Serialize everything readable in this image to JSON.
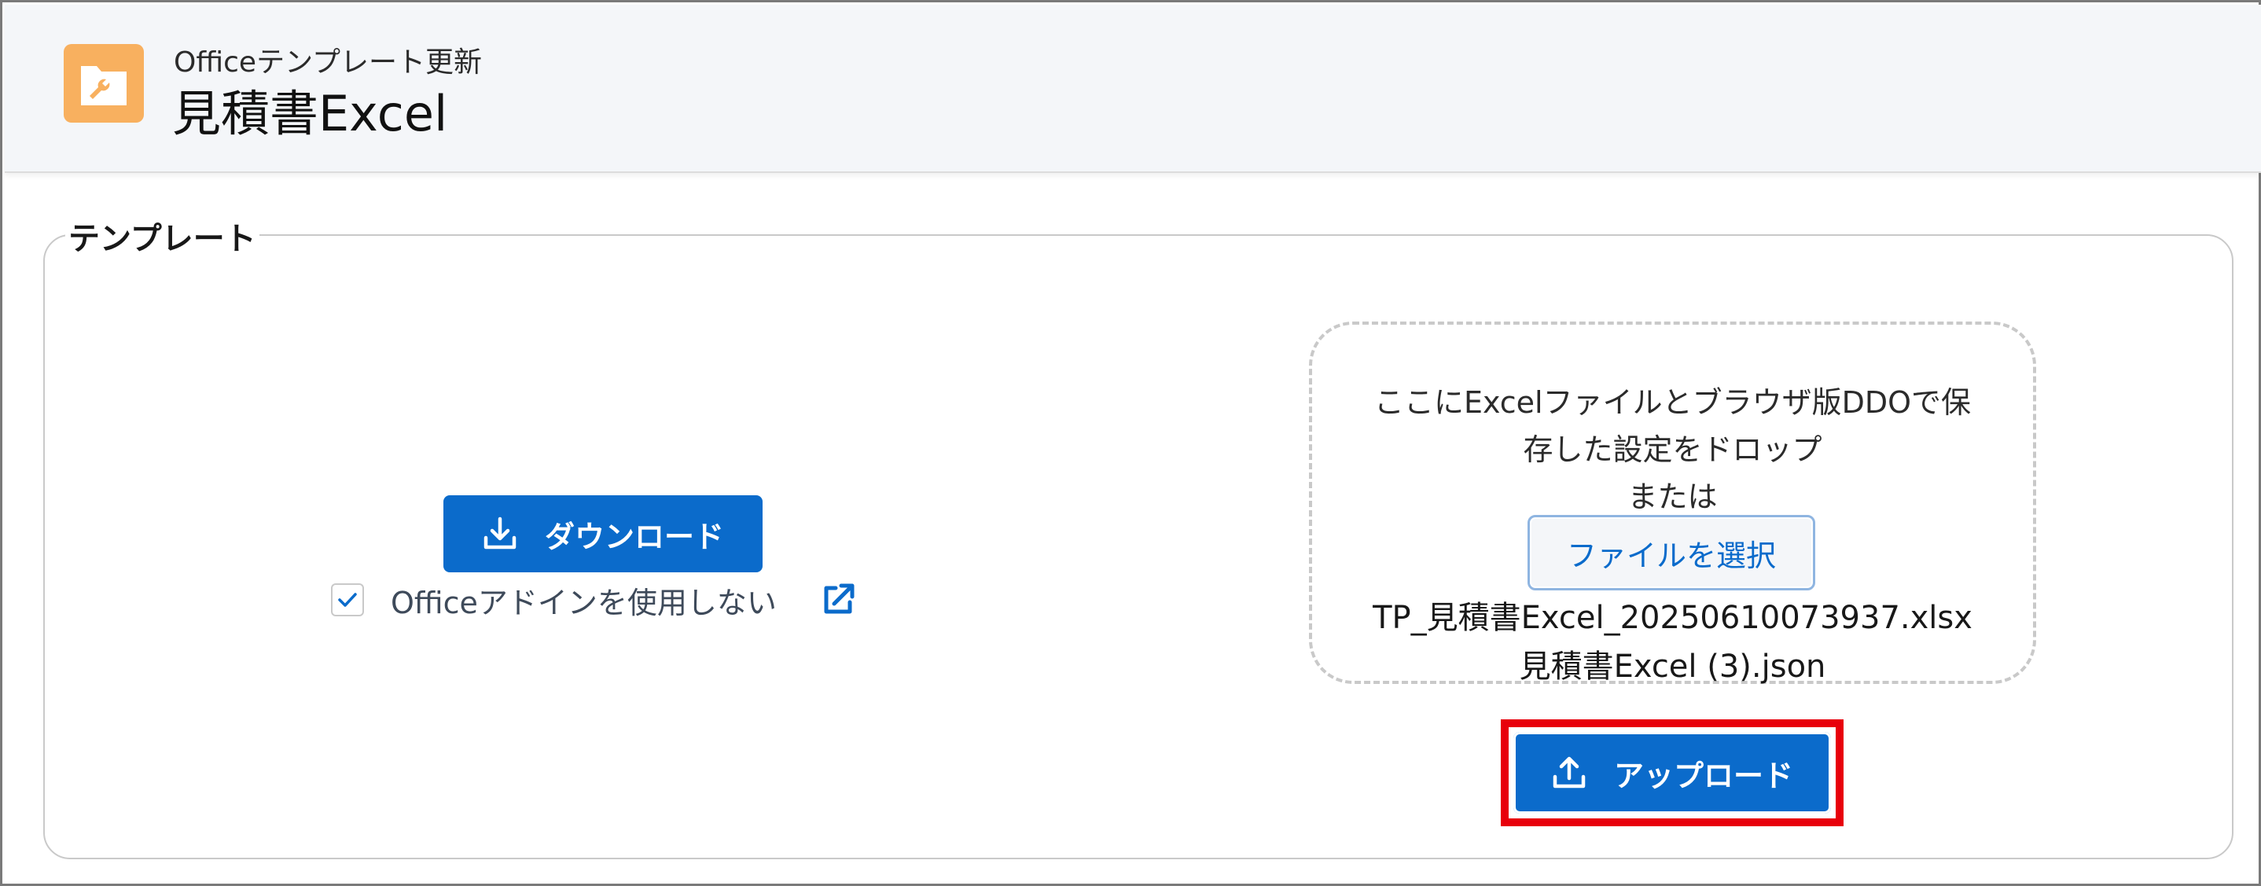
{
  "header": {
    "icon": "folder-wrench-icon",
    "subtitle": "Officeテンプレート更新",
    "title": "見積書Excel"
  },
  "section": {
    "legend": "テンプレート"
  },
  "download": {
    "label": "ダウンロード",
    "icon": "download-icon"
  },
  "addin_option": {
    "label": "Officeアドインを使用しない",
    "checked": true,
    "link_icon": "external-link-icon"
  },
  "dropzone": {
    "line1": "ここにExcelファイルとブラウザ版DDOで保",
    "line2": "存した設定をドロップ",
    "line3": "または",
    "select_button": "ファイルを選択",
    "files": [
      "TP_見積書Excel_20250610073937.xlsx",
      "見積書Excel (3).json"
    ]
  },
  "upload": {
    "label": "アップロード",
    "icon": "upload-icon"
  },
  "colors": {
    "brand": "#0b6bcb",
    "app_icon": "#f8b05f",
    "highlight": "#e8000b"
  }
}
